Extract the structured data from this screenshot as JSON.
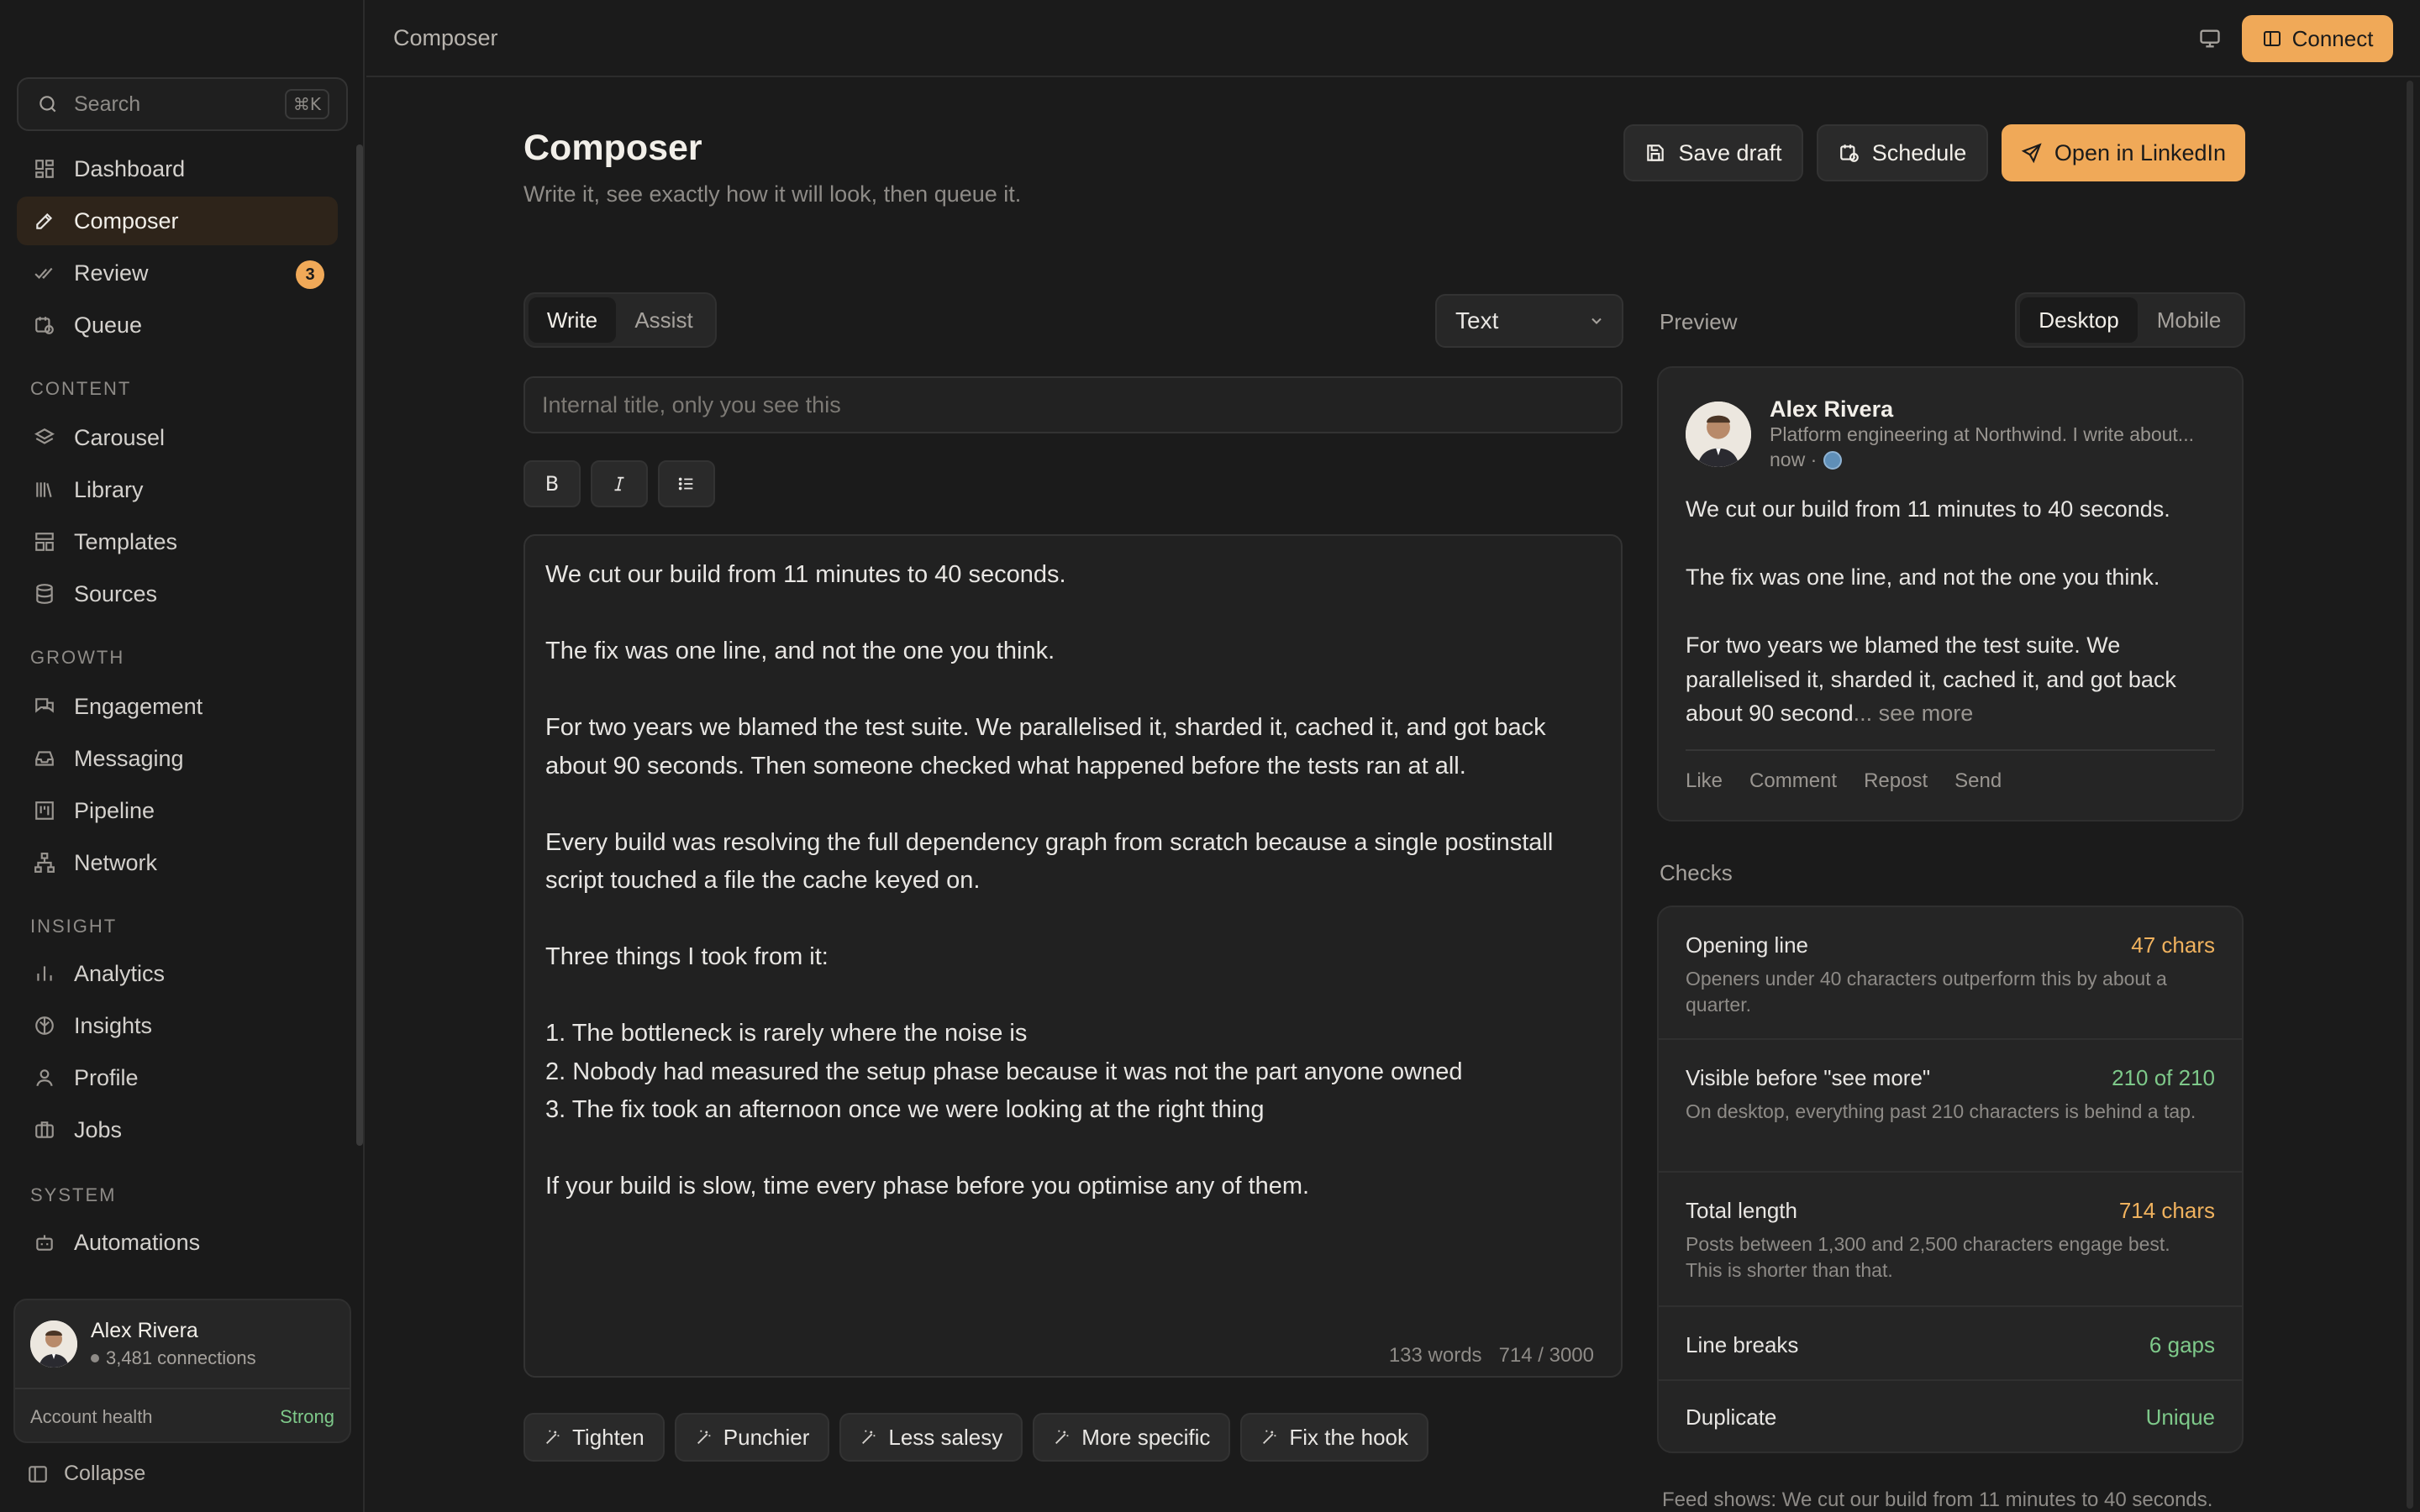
{
  "sidebar": {
    "search": {
      "label": "Search",
      "shortcut": "⌘K"
    },
    "nav": [
      {
        "label": "Dashboard",
        "icon": "dashboard-icon"
      },
      {
        "label": "Composer",
        "icon": "pencil-icon",
        "active": true
      },
      {
        "label": "Review",
        "icon": "double-check-icon",
        "badge": "3"
      },
      {
        "label": "Queue",
        "icon": "clock-calendar-icon"
      }
    ],
    "sections": [
      {
        "title": "CONTENT",
        "items": [
          {
            "label": "Carousel",
            "icon": "layers-icon"
          },
          {
            "label": "Library",
            "icon": "library-icon"
          },
          {
            "label": "Templates",
            "icon": "template-icon"
          },
          {
            "label": "Sources",
            "icon": "database-icon"
          }
        ]
      },
      {
        "title": "GROWTH",
        "items": [
          {
            "label": "Engagement",
            "icon": "chat-icon"
          },
          {
            "label": "Messaging",
            "icon": "inbox-icon"
          },
          {
            "label": "Pipeline",
            "icon": "kanban-icon"
          },
          {
            "label": "Network",
            "icon": "network-icon"
          }
        ]
      },
      {
        "title": "INSIGHT",
        "items": [
          {
            "label": "Analytics",
            "icon": "bar-chart-icon"
          },
          {
            "label": "Insights",
            "icon": "brain-icon"
          },
          {
            "label": "Profile",
            "icon": "user-icon"
          },
          {
            "label": "Jobs",
            "icon": "briefcase-icon"
          }
        ]
      },
      {
        "title": "SYSTEM",
        "items": [
          {
            "label": "Automations",
            "icon": "bot-icon"
          }
        ]
      }
    ],
    "user": {
      "name": "Alex Rivera",
      "connections": "3,481 connections",
      "health_label": "Account health",
      "health_value": "Strong"
    },
    "collapse_label": "Collapse"
  },
  "topbar": {
    "breadcrumb": "Composer",
    "connect_label": "Connect"
  },
  "header": {
    "title": "Composer",
    "subtitle": "Write it, see exactly how it will look, then queue it.",
    "save_draft": "Save draft",
    "schedule": "Schedule",
    "open_linkedin": "Open in LinkedIn"
  },
  "editor": {
    "tabs": [
      "Write",
      "Assist"
    ],
    "active_tab": "Write",
    "format_type": "Text",
    "title_placeholder": "Internal title, only you see this",
    "body": "We cut our build from 11 minutes to 40 seconds.\n\nThe fix was one line, and not the one you think.\n\nFor two years we blamed the test suite. We parallelised it, sharded it, cached it, and got back about 90 seconds. Then someone checked what happened before the tests ran at all.\n\nEvery build was resolving the full dependency graph from scratch because a single postinstall script touched a file the cache keyed on.\n\nThree things I took from it:\n\n1. The bottleneck is rarely where the noise is\n2. Nobody had measured the setup phase because it was not the part anyone owned\n3. The fix took an afternoon once we were looking at the right thing\n\nIf your build is slow, time every phase before you optimise any of them.",
    "word_count": "133 words",
    "char_count": "714 / 3000",
    "assist_chips": [
      "Tighten",
      "Punchier",
      "Less salesy",
      "More specific",
      "Fix the hook"
    ]
  },
  "preview": {
    "label": "Preview",
    "modes": [
      "Desktop",
      "Mobile"
    ],
    "active_mode": "Desktop",
    "author": "Alex Rivera",
    "headline": "Platform engineering at Northwind. I write about...",
    "meta": "now ·",
    "paragraphs": [
      "We cut our build from 11 minutes to 40 seconds.",
      "The fix was one line, and not the one you think.",
      "For two years we blamed the test suite. We parallelised it, sharded it, cached it, and got back about 90 second"
    ],
    "see_more": "... see more",
    "actions": [
      "Like",
      "Comment",
      "Repost",
      "Send"
    ]
  },
  "checks": {
    "label": "Checks",
    "items": [
      {
        "title": "Opening line",
        "value": "47 chars",
        "status": "warn",
        "desc": "Openers under 40 characters outperform this by about a quarter."
      },
      {
        "title": "Visible before \"see more\"",
        "value": "210 of 210",
        "status": "good",
        "desc": "On desktop, everything past 210 characters is behind a tap."
      },
      {
        "title": "Total length",
        "value": "714 chars",
        "status": "warn",
        "desc": "Posts between 1,300 and 2,500 characters engage best. This is shorter than that."
      },
      {
        "title": "Line breaks",
        "value": "6 gaps",
        "status": "good",
        "desc": ""
      },
      {
        "title": "Duplicate",
        "value": "Unique",
        "status": "good",
        "desc": ""
      }
    ],
    "feed_shows": "Feed shows: We cut our build from 11 minutes to 40 seconds."
  },
  "colors": {
    "accent": "#f0a958",
    "good": "#7ec98a",
    "warn": "#f0b25e",
    "bg": "#1b1b1b"
  }
}
